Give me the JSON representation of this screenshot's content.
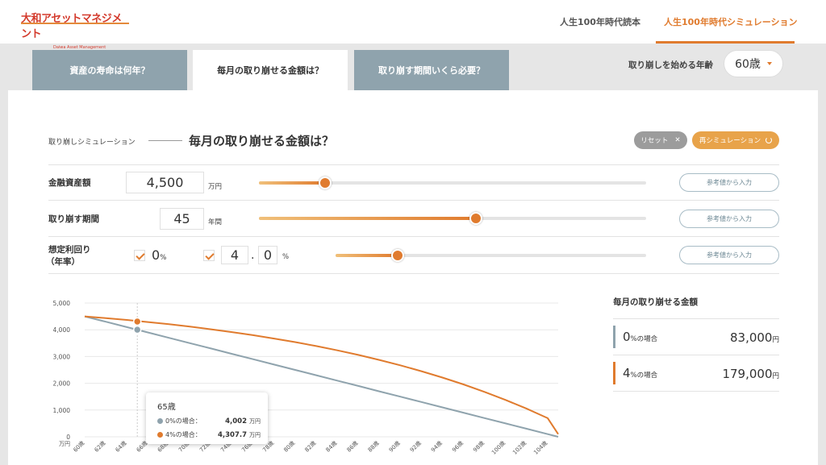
{
  "brand": {
    "name": "大和アセットマネジメント",
    "sub": "Daiwa Asset Management"
  },
  "nav": [
    {
      "label": "人生100年時代読本"
    },
    {
      "label": "人生100年時代シミュレーション"
    }
  ],
  "tabs": [
    {
      "label": "資産の寿命は何年？"
    },
    {
      "label": "毎月の取り崩せる金額は？"
    },
    {
      "label": "取り崩す期間いくら必要？"
    }
  ],
  "start_age": {
    "label": "取り崩しを始める年齢",
    "value": "60歳"
  },
  "sim": {
    "label": "取り崩しシミュレーション",
    "title": "毎月の取り崩せる金額は？",
    "reset_label": "リセット",
    "resim_label": "再シミュレーション"
  },
  "inputs": {
    "assets": {
      "label": "金融資産額",
      "value": "4,500",
      "unit": "万円",
      "slider": 0.17
    },
    "period": {
      "label": "取り崩す期間",
      "value": "45",
      "unit": "年間",
      "slider": 0.56
    },
    "rate": {
      "label_line1": "想定利回り",
      "label_line2": "（年率）",
      "zero_value": "0",
      "zero_unit": "%",
      "int_part": "4",
      "sep": ".",
      "dec_part": "0",
      "unit": "%",
      "slider": 0.2
    },
    "ref_label": "参考値から入力"
  },
  "chart_data": {
    "type": "line",
    "x": [
      60,
      62,
      64,
      66,
      68,
      70,
      72,
      74,
      76,
      78,
      80,
      82,
      84,
      86,
      88,
      90,
      92,
      94,
      96,
      98,
      100,
      102,
      104,
      105
    ],
    "x_tick_labels": [
      "60歳",
      "62歳",
      "64歳",
      "66歳",
      "68歳",
      "70歳",
      "72歳",
      "74歳",
      "76歳",
      "78歳",
      "80歳",
      "82歳",
      "84歳",
      "86歳",
      "88歳",
      "90歳",
      "92歳",
      "94歳",
      "96歳",
      "98歳",
      "100歳",
      "102歳",
      "104歳"
    ],
    "ylabel": "万円",
    "ylim": [
      0,
      5000
    ],
    "y_ticks": [
      {
        "value": 0,
        "label": "0"
      },
      {
        "value": 1000,
        "label": "1,000"
      },
      {
        "value": 2000,
        "label": "2,000"
      },
      {
        "value": 3000,
        "label": "3,000"
      },
      {
        "value": 4000,
        "label": "4,000"
      },
      {
        "value": 5000,
        "label": "5,000"
      }
    ],
    "grid": true,
    "series": [
      {
        "color": "#8fa3ad",
        "values": [
          4500,
          4300,
          4100,
          3900,
          3700,
          3500,
          3300,
          3100,
          2900,
          2700,
          2500,
          2300,
          2100,
          1900,
          1700,
          1500,
          1300,
          1100,
          900,
          700,
          500,
          300,
          100,
          0
        ]
      },
      {
        "color": "#e07b2e",
        "values": [
          4500,
          4437,
          4367,
          4290,
          4207,
          4117,
          4019,
          3913,
          3798,
          3673,
          3538,
          3391,
          3232,
          3060,
          2873,
          2671,
          2452,
          2215,
          1958,
          1679,
          1377,
          1050,
          696,
          100
        ]
      }
    ],
    "highlight_x": 65
  },
  "tooltip": {
    "age": "65歳",
    "rows": [
      {
        "label": "0%の場合：",
        "value": "4,002",
        "unit": "万円",
        "color": "#8fa3ad"
      },
      {
        "label": "4%の場合：",
        "value": "4,307.7",
        "unit": "万円",
        "color": "#e07b2e"
      }
    ]
  },
  "results": {
    "title": "毎月の取り崩せる金額",
    "rows": [
      {
        "rate": "0",
        "suffix": "%の場合",
        "value": "83,000",
        "unit": "円",
        "color": "#8fa3ad"
      },
      {
        "rate": "4",
        "suffix": "%の場合",
        "value": "179,000",
        "unit": "円",
        "color": "#e07b2e"
      }
    ]
  }
}
